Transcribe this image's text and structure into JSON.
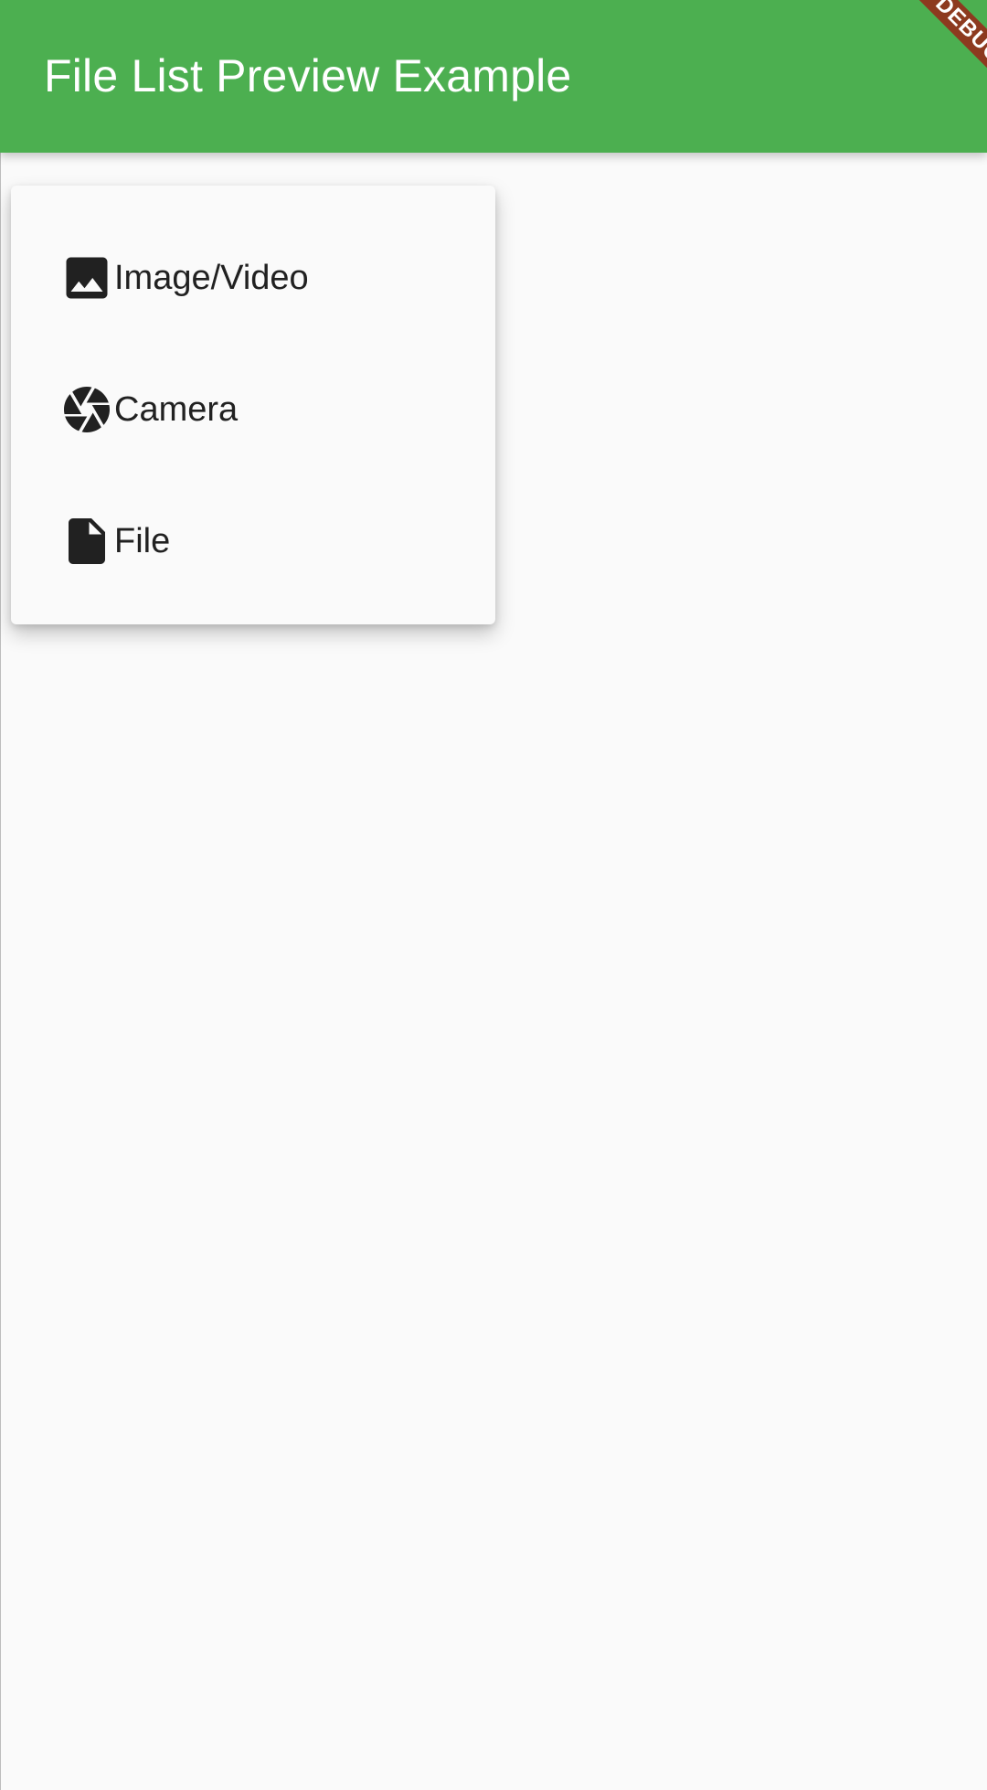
{
  "app_bar": {
    "title": "File List Preview Example",
    "background": "#4caf50",
    "debug_banner": "DEBUG"
  },
  "menu": {
    "items": [
      {
        "label": "Image/Video",
        "icon": "image-icon"
      },
      {
        "label": "Camera",
        "icon": "camera-aperture-icon"
      },
      {
        "label": "File",
        "icon": "file-icon"
      }
    ]
  }
}
